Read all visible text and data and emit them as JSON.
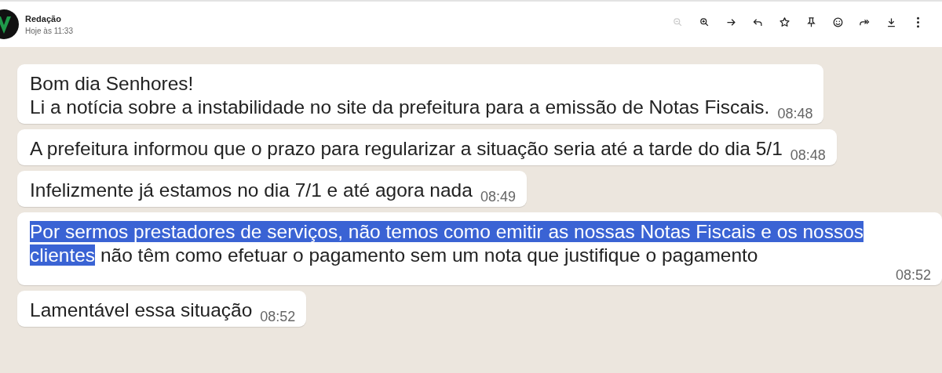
{
  "header": {
    "sender": "Redação",
    "date": "Hoje às 11:33"
  },
  "toolbar": [
    {
      "kind": "zoom-out",
      "disabled": true
    },
    {
      "kind": "zoom-in",
      "disabled": false
    },
    {
      "kind": "forward",
      "disabled": false
    },
    {
      "kind": "reply",
      "disabled": false
    },
    {
      "kind": "star",
      "disabled": false
    },
    {
      "kind": "pin",
      "disabled": false
    },
    {
      "kind": "emoji",
      "disabled": false
    },
    {
      "kind": "forward-all",
      "disabled": false
    },
    {
      "kind": "download",
      "disabled": false
    },
    {
      "kind": "more",
      "disabled": false
    }
  ],
  "messages": [
    {
      "parts": [
        {
          "text": "Bom dia Senhores!\nLi a notícia sobre a instabilidade no site da prefeitura para a emissão de Notas Fiscais.",
          "selected": false
        }
      ],
      "time": "08:48"
    },
    {
      "parts": [
        {
          "text": "A prefeitura informou que o prazo para regularizar a situação seria até a tarde do dia 5/1",
          "selected": false
        }
      ],
      "time": "08:48"
    },
    {
      "parts": [
        {
          "text": "Infelizmente já estamos no dia 7/1 e até agora nada",
          "selected": false
        }
      ],
      "time": "08:49"
    },
    {
      "parts": [
        {
          "text": "Por sermos prestadores de serviços, não temos como emitir as nossas Notas Fiscais e os nossos clientes",
          "selected": true
        },
        {
          "text": " não têm como efetuar o pagamento sem um nota que justifique o pagamento",
          "selected": false
        }
      ],
      "time": "08:52"
    },
    {
      "parts": [
        {
          "text": "Lamentável essa situação",
          "selected": false
        }
      ],
      "time": "08:52"
    }
  ]
}
